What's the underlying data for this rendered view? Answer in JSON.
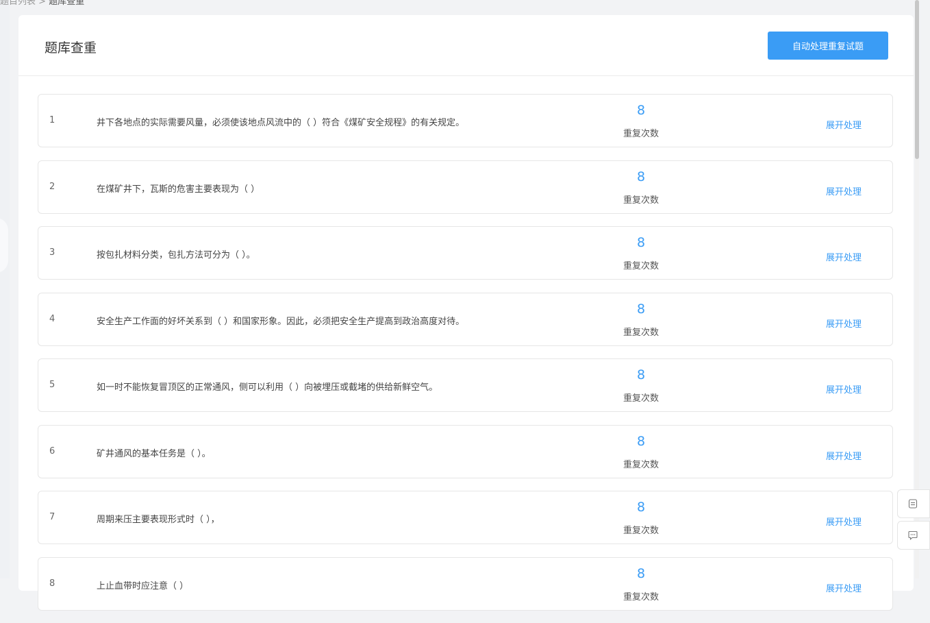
{
  "breadcrumb": {
    "parent": "题目列表",
    "separator": " > ",
    "current": "题库查重"
  },
  "header": {
    "title": "题库查重",
    "auto_button": "自动处理重复试题"
  },
  "items": [
    {
      "index": "1",
      "text": "井下各地点的实际需要风量，必须使该地点风流中的（    ）符合《煤矿安全规程》的有关规定。",
      "count": "8",
      "count_label": "重复次数",
      "action": "展开处理"
    },
    {
      "index": "2",
      "text": "在煤矿井下，瓦斯的危害主要表现为（   ）",
      "count": "8",
      "count_label": "重复次数",
      "action": "展开处理"
    },
    {
      "index": "3",
      "text": "按包扎材料分类，包扎方法可分为（   ）。",
      "count": "8",
      "count_label": "重复次数",
      "action": "展开处理"
    },
    {
      "index": "4",
      "text": "安全生产工作面的好坏关系到（     ）和国家形象。因此，必须把安全生产提高到政治高度对待。",
      "count": "8",
      "count_label": "重复次数",
      "action": "展开处理"
    },
    {
      "index": "5",
      "text": "如一时不能恢复冒顶区的正常通风，侧可以利用（   ）向被埋压或截堵的供给新鲜空气。",
      "count": "8",
      "count_label": "重复次数",
      "action": "展开处理"
    },
    {
      "index": "6",
      "text": "矿井通风的基本任务是（   ）。",
      "count": "8",
      "count_label": "重复次数",
      "action": "展开处理"
    },
    {
      "index": "7",
      "text": "周期来压主要表现形式时（     ），",
      "count": "8",
      "count_label": "重复次数",
      "action": "展开处理"
    },
    {
      "index": "8",
      "text": "上止血带时应注意（   ）",
      "count": "8",
      "count_label": "重复次数",
      "action": "展开处理"
    }
  ],
  "float_tools": [
    {
      "icon": "document-icon"
    },
    {
      "icon": "chat-icon"
    }
  ],
  "colors": {
    "accent": "#3a9cf5",
    "background": "#f2f3f5"
  }
}
